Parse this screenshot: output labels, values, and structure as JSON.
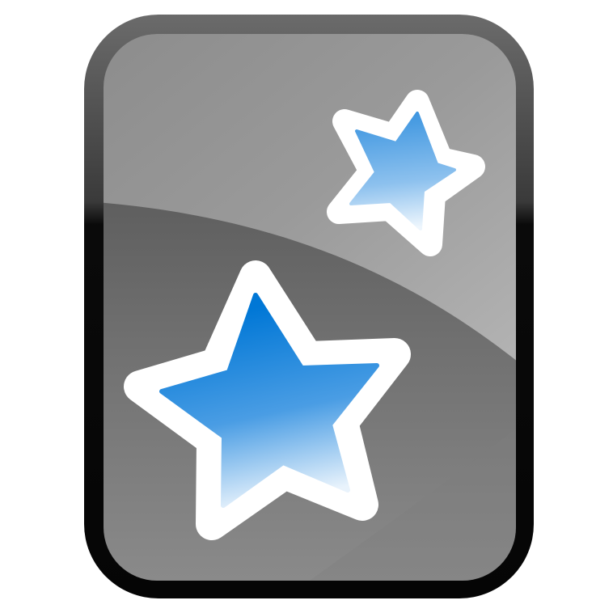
{
  "icon": {
    "name": "anki-app-icon",
    "shape": "rounded-card",
    "glyphs": [
      "large-star-icon",
      "small-star-icon"
    ]
  },
  "colors": {
    "background": "#ffffff",
    "card_outline_light": "#6b6b6b",
    "card_outline_dark": "#0a0a0a",
    "card_fill_light": "#9a9a9a",
    "card_fill_mid": "#6f6f6f",
    "card_fill_dark": "#4a4a4a",
    "gloss_light": "#b4b4b4",
    "star_outline": "#ffffff",
    "star_blue_deep": "#0077d6",
    "star_blue_mid": "#4a9de4",
    "star_blue_light": "#e9f3fc"
  }
}
